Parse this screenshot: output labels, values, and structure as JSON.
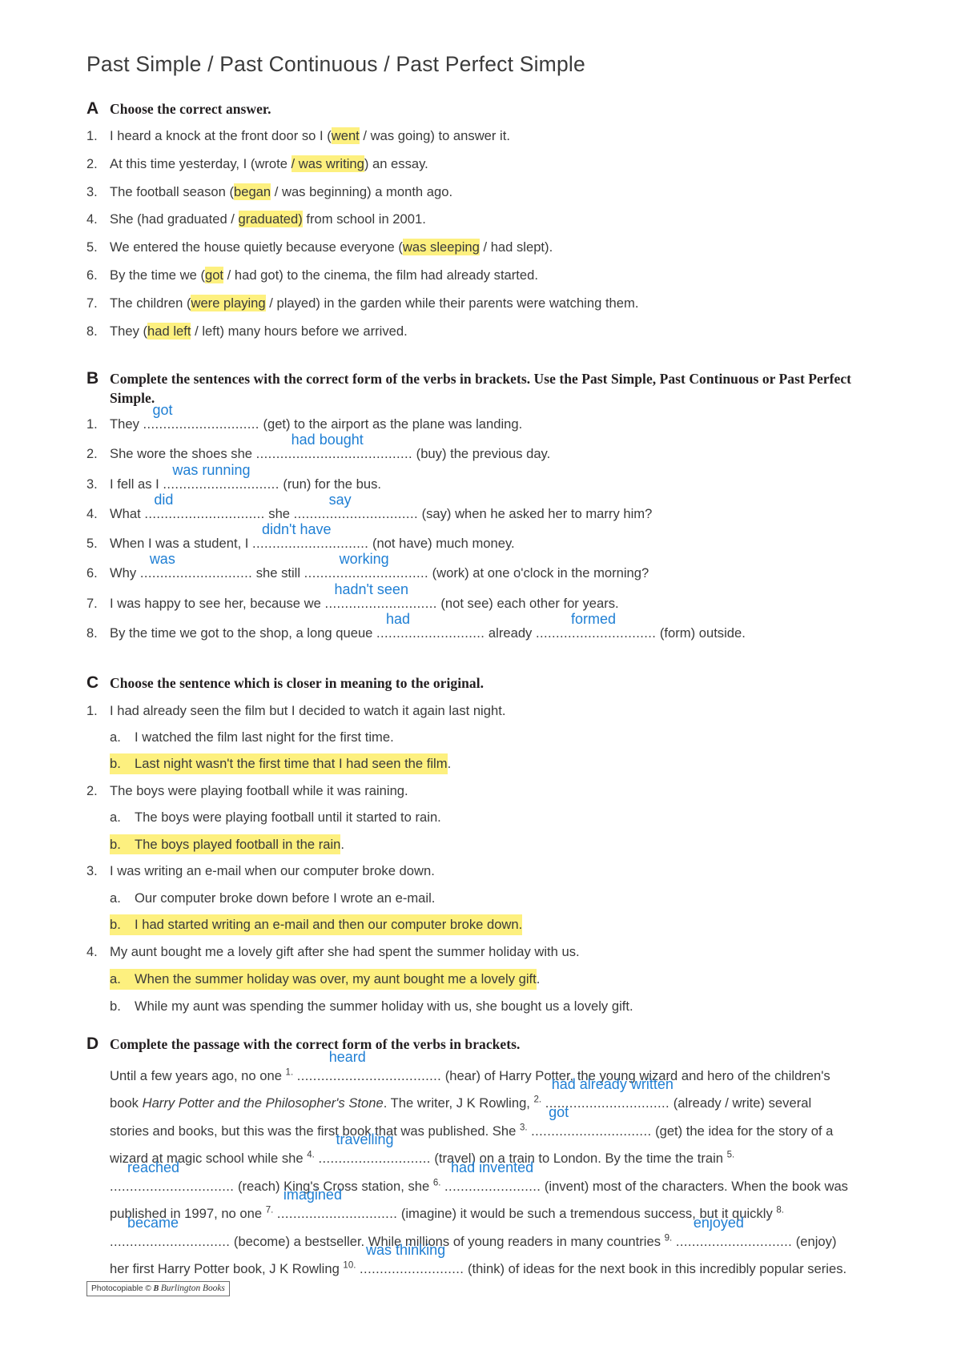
{
  "page": {
    "title": "Past Simple / Past Continuous / Past Perfect Simple"
  },
  "sections": {
    "a": {
      "letter": "A",
      "title": "Choose the correct answer.",
      "items": [
        {
          "num": "1.",
          "pre": "I heard a knock at the front door so I ",
          "open": "(",
          "hl": "went",
          "rest": " / was going) to answer it.",
          "style": "open-before"
        },
        {
          "num": "2.",
          "pre": "At this time yesterday, I (wrote ",
          "hl": "/ was writing",
          "rest": ") an essay.",
          "style": "mid"
        },
        {
          "num": "3.",
          "pre": "The football season ",
          "open": "(",
          "hl": "began",
          "rest": " / was beginning) a month ago.",
          "style": "open-before"
        },
        {
          "num": "4.",
          "pre": "She (had graduated / ",
          "hl": "graduated)",
          "rest": " from school in 2001.",
          "style": "mid"
        },
        {
          "num": "5.",
          "pre": "We entered the house quietly because everyone ",
          "open": "(",
          "hl": "was sleeping",
          "rest": " / had slept).",
          "style": "open-before"
        },
        {
          "num": "6.",
          "pre": "By the time we ",
          "open": "(",
          "hl": "got",
          "rest": " / had got) to the cinema, the film had already started.",
          "style": "open-before"
        },
        {
          "num": "7.",
          "pre": "The children ",
          "open": "(",
          "hl": "were playing",
          "rest": " / played) in the garden while their parents were watching them.",
          "style": "open-before"
        },
        {
          "num": "8.",
          "pre": "They ",
          "open": "(",
          "hl": "had left",
          "rest": " / left) many hours before we arrived.",
          "style": "open-before"
        }
      ]
    },
    "b": {
      "letter": "B",
      "title": "Complete the sentences with the correct form of the verbs in brackets. Use the Past Simple, Past Continuous or Past Perfect Simple.",
      "items": [
        {
          "num": "1.",
          "parts": [
            {
              "text": "They "
            },
            {
              "blank": true,
              "dots": ".............................",
              "answer": "got",
              "offset": "pad4"
            },
            {
              "text": " (get) to the airport as the plane was landing."
            }
          ]
        },
        {
          "num": "2.",
          "parts": [
            {
              "text": "She wore the shoes she "
            },
            {
              "blank": true,
              "dots": ".......................................",
              "answer": "had bought",
              "offset": "pad2"
            },
            {
              "text": " (buy) the previous day."
            }
          ]
        },
        {
          "num": "3.",
          "parts": [
            {
              "text": "I fell as I "
            },
            {
              "blank": true,
              "dots": ".............................",
              "answer": "was running",
              "offset": "pad4"
            },
            {
              "text": " (run) for the bus."
            }
          ]
        },
        {
          "num": "4.",
          "parts": [
            {
              "text": "What "
            },
            {
              "blank": true,
              "dots": "..............................",
              "answer": "did",
              "offset": "pad4"
            },
            {
              "text": " she "
            },
            {
              "blank": true,
              "dots": "...............................",
              "answer": "say",
              "offset": "pad2"
            },
            {
              "text": " (say) when he asked her to marry him?"
            }
          ]
        },
        {
          "num": "5.",
          "parts": [
            {
              "text": "When I was a student, I "
            },
            {
              "blank": true,
              "dots": ".............................",
              "answer": "didn't have",
              "offset": "pad4"
            },
            {
              "text": " (not have) much money."
            }
          ]
        },
        {
          "num": "6.",
          "parts": [
            {
              "text": "Why "
            },
            {
              "blank": true,
              "dots": "............................",
              "answer": "was",
              "offset": "pad4"
            },
            {
              "text": " she still "
            },
            {
              "blank": true,
              "dots": "...............................",
              "answer": "working",
              "offset": "pad2"
            },
            {
              "text": " (work) at one o'clock in the morning?"
            }
          ]
        },
        {
          "num": "7.",
          "parts": [
            {
              "text": "I was happy to see her, because we "
            },
            {
              "blank": true,
              "dots": "............................",
              "answer": "hadn't seen",
              "offset": "pad4"
            },
            {
              "text": " (not see) each other for years."
            }
          ]
        },
        {
          "num": "8.",
          "parts": [
            {
              "text": "By the time we got to the shop, a long queue "
            },
            {
              "blank": true,
              "dots": "...........................",
              "answer": "had",
              "offset": "pad4"
            },
            {
              "text": " already "
            },
            {
              "blank": true,
              "dots": "..............................",
              "answer": "formed",
              "offset": "pad2"
            },
            {
              "text": " (form) outside."
            }
          ]
        }
      ]
    },
    "c": {
      "letter": "C",
      "title": "Choose the sentence which is closer in meaning to the original.",
      "items": [
        {
          "num": "1.",
          "prompt": "I had already seen the film but I decided to watch it again last night.",
          "options": [
            {
              "letter": "a.",
              "text": "I watched the film last night for the first time.",
              "highlight": false
            },
            {
              "letter": "b.",
              "text": "Last night wasn't the first time that I had seen the film",
              "tail": ".",
              "highlight": true
            }
          ]
        },
        {
          "num": "2.",
          "prompt": "The boys were playing football while it was raining.",
          "options": [
            {
              "letter": "a.",
              "text": "The boys were playing football until it started to rain.",
              "highlight": false
            },
            {
              "letter": "b.",
              "text": "The boys played football in the rain",
              "tail": ".",
              "highlight": true
            }
          ]
        },
        {
          "num": "3.",
          "prompt": "I was writing an e-mail when our computer broke down.",
          "options": [
            {
              "letter": "a.",
              "text": "Our computer broke down before I wrote an e-mail.",
              "highlight": false
            },
            {
              "letter": "b.",
              "text": "I had started writing an e-mail and then our computer broke down.",
              "tail": "",
              "highlight": true
            }
          ]
        },
        {
          "num": "4.",
          "prompt": "My aunt bought me a lovely gift after she had spent the summer holiday with us.",
          "options": [
            {
              "letter": "a.",
              "text": "When the summer holiday was over, my aunt bought me a lovely gift",
              "tail": ".",
              "highlight": true
            },
            {
              "letter": "b.",
              "text": "While my aunt was spending the summer holiday with us, she bought us a lovely gift.",
              "highlight": false
            }
          ]
        }
      ]
    },
    "d": {
      "letter": "D",
      "title": "Complete the passage with the correct form of the verbs in brackets.",
      "passage": {
        "t1": "Until a few years ago, no one ",
        "n1": "1.",
        "dots1": "....................................",
        "a1": "heard",
        "t2": " (hear) of Harry Potter, the young wizard and hero of the children's book ",
        "em1": "Harry Potter and the Philosopher's Stone",
        "t3": ". The writer, J K Rowling, ",
        "n2": "2.",
        "dots2": "...............................",
        "a2": "had already written",
        "t4": " (already / write) several stories and books, but this was the first book that was published. She ",
        "n3": "3.",
        "dots3": "..............................",
        "a3": "got",
        "t5": " (get) the idea for the story of a wizard at magic school while she ",
        "n4": "4.",
        "dots4": "............................",
        "a4": "travelling",
        "t6": " (travel) on a train to London. By the time the train ",
        "n5": "5.",
        "dots5": "...............................",
        "a5": "reached",
        "t7": " (reach) King's Cross station, she ",
        "n6": "6.",
        "dots6": "........................",
        "a6": "had invented",
        "t8": " (invent) most of the characters. When the book was published in 1997, no one ",
        "n7": "7.",
        "dots7": "..............................",
        "a7": "imagined",
        "t9": " (imagine) it would be such a tremendous success, but it quickly ",
        "n8": "8.",
        "dots8": "..............................",
        "a8": "became",
        "t10": " (become) a bestseller. While millions of young readers in many countries ",
        "n9": "9.",
        "dots9": ".............................",
        "a9": "enjoyed",
        "t11": " (enjoy) her first Harry Potter book, J K Rowling ",
        "n10": "10.",
        "dots10": "..........................",
        "a10": "was thinking",
        "t12": " (think) of ideas for the next book in this incredibly popular series."
      }
    }
  },
  "footer": {
    "prefix": "Photocopiable ",
    "copyright": "©",
    "mark": " B ",
    "publisher": "Burlington Books"
  },
  "colors": {
    "highlight": "#fdf07f",
    "answer_blue": "#1f7fd4",
    "text": "#3a3a3a"
  }
}
